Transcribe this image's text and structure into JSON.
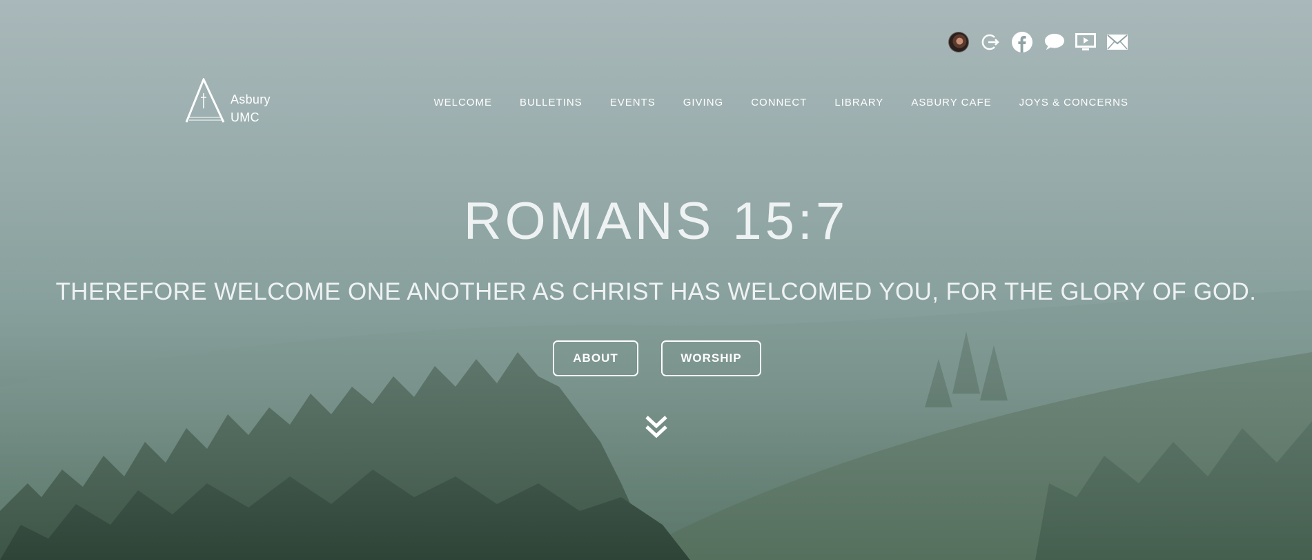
{
  "site": {
    "logo_line1": "Asbury",
    "logo_line2": "UMC"
  },
  "social_icons": [
    "avatar",
    "login-icon",
    "facebook-icon",
    "chat-icon",
    "video-icon",
    "mail-icon"
  ],
  "nav": {
    "items": [
      {
        "label": "WELCOME"
      },
      {
        "label": "BULLETINS"
      },
      {
        "label": "EVENTS"
      },
      {
        "label": "GIVING"
      },
      {
        "label": "CONNECT"
      },
      {
        "label": "LIBRARY"
      },
      {
        "label": "ASBURY CAFE"
      },
      {
        "label": "JOYS & CONCERNS"
      }
    ]
  },
  "hero": {
    "verse_ref": "ROMANS 15:7",
    "verse_text": "THEREFORE WELCOME ONE ANOTHER AS CHRIST HAS WELCOMED YOU, FOR THE GLORY OF GOD.",
    "buttons": {
      "about": "ABOUT",
      "worship": "WORSHIP"
    },
    "scroll_icon": "double-chevron-down-icon"
  },
  "colors": {
    "text": "#ffffff",
    "fog": "#a6b5b7",
    "forest": "#3f5a4a"
  }
}
